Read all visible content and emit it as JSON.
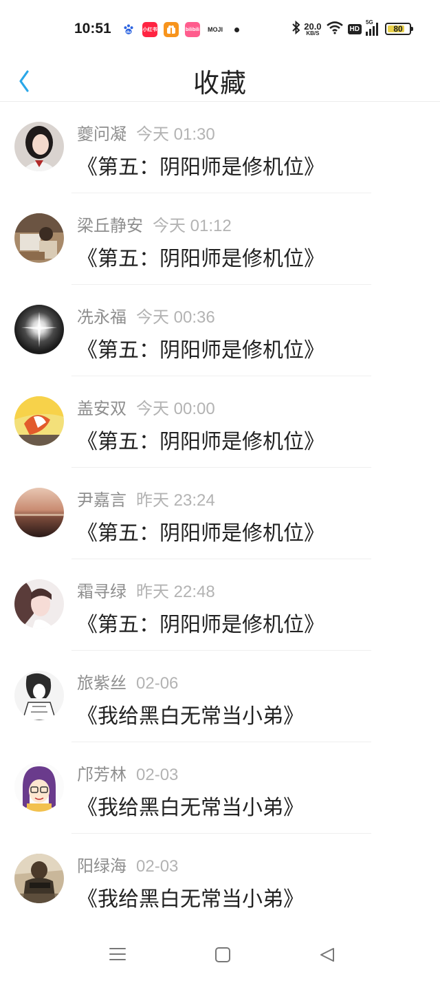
{
  "status_bar": {
    "time": "10:51",
    "notifications": [
      {
        "icon": "baidu-icon",
        "label": ""
      },
      {
        "icon": "xiaohongshu-icon",
        "label": "小红书"
      },
      {
        "icon": "gift-app-icon",
        "label": ""
      },
      {
        "icon": "bilibili-icon",
        "label": "bilibili"
      },
      {
        "icon": "moji-icon",
        "label": "MOJI"
      }
    ],
    "net_speed": "20.0",
    "net_unit": "KB/S",
    "hd_label": "HD",
    "network_label": "5G",
    "battery": "80",
    "battery_level": 0.8,
    "battery_color": "#e9d14a"
  },
  "header": {
    "title": "收藏",
    "back_icon": "chevron-left-icon",
    "accent_color": "#2aa7e8"
  },
  "favorites": [
    {
      "user": "夔问凝",
      "time": "今天 01:30",
      "title": "《第五：阴阳师是修机位》",
      "avatar": "girl-portrait"
    },
    {
      "user": "梁丘静安",
      "time": "今天 01:12",
      "title": "《第五：阴阳师是修机位》",
      "avatar": "desk-photo"
    },
    {
      "user": "冼永福",
      "time": "今天 00:36",
      "title": "《第五：阴阳师是修机位》",
      "avatar": "light-flare"
    },
    {
      "user": "盖安双",
      "time": "今天 00:00",
      "title": "《第五：阴阳师是修机位》",
      "avatar": "anime-art"
    },
    {
      "user": "尹嘉言",
      "time": "昨天 23:24",
      "title": "《第五：阴阳师是修机位》",
      "avatar": "sunset-sea"
    },
    {
      "user": "霜寻绿",
      "time": "昨天 22:48",
      "title": "《第五：阴阳师是修机位》",
      "avatar": "girl-portrait-soft"
    },
    {
      "user": "旅紫丝",
      "time": "02-06",
      "title": "《我给黑白无常当小弟》",
      "avatar": "manga-sketch"
    },
    {
      "user": "邝芳林",
      "time": "02-03",
      "title": "《我给黑白无常当小弟》",
      "avatar": "purple-hair-cartoon"
    },
    {
      "user": "阳绿海",
      "time": "02-03",
      "title": "《我给黑白无常当小弟》",
      "avatar": "soldier-game"
    }
  ],
  "system_nav": {
    "menu_icon": "menu-icon",
    "home_icon": "home-square-icon",
    "back_icon": "back-triangle-icon"
  }
}
